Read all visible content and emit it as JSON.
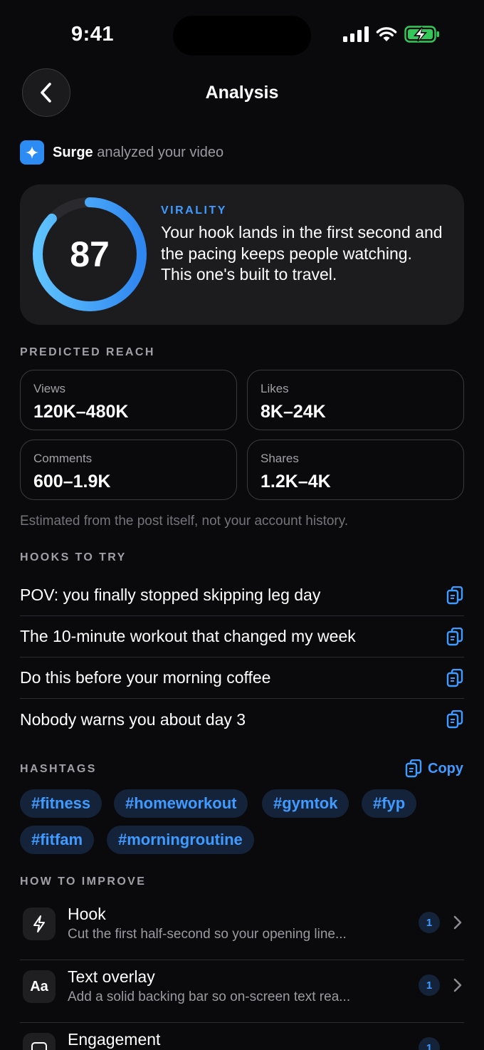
{
  "status_bar": {
    "time": "9:41"
  },
  "nav": {
    "title": "Analysis",
    "back_icon": "chevron-left-icon"
  },
  "surge": {
    "name": "Surge",
    "text": "analyzed your video",
    "icon": "sparkle-icon"
  },
  "virality": {
    "score": "87",
    "score_fraction": 0.87,
    "label": "VIRALITY",
    "description": "Your hook lands in the first second and the pacing keeps people watching. This one's built to travel."
  },
  "reach": {
    "section_label": "PREDICTED REACH",
    "stats": [
      {
        "label": "Views",
        "value": "120K–480K"
      },
      {
        "label": "Likes",
        "value": "8K–24K"
      },
      {
        "label": "Comments",
        "value": "600–1.9K"
      },
      {
        "label": "Shares",
        "value": "1.2K–4K"
      }
    ],
    "note": "Estimated from the post itself, not your account history."
  },
  "hooks": {
    "section_label": "HOOKS TO TRY",
    "items": [
      "POV: you finally stopped skipping leg day",
      "The 10-minute workout that changed my week",
      "Do this before your morning coffee",
      "Nobody warns you about day 3"
    ]
  },
  "hashtags": {
    "section_label": "HASHTAGS",
    "copy_label": "Copy",
    "tags": [
      "#fitness",
      "#homeworkout",
      "#gymtok",
      "#fyp",
      "#fitfam",
      "#morningroutine"
    ]
  },
  "improve": {
    "section_label": "HOW TO IMPROVE",
    "items": [
      {
        "title": "Hook",
        "desc": "Cut the first half-second so your opening line...",
        "count": "1",
        "icon": "lightning-icon"
      },
      {
        "title": "Text overlay",
        "desc": "Add a solid backing bar so on-screen text rea...",
        "count": "1",
        "icon": "text-aa-icon",
        "icon_text": "Aa"
      },
      {
        "title": "Engagement",
        "desc": "",
        "count": "1",
        "icon": "chat-icon"
      }
    ]
  },
  "colors": {
    "accent": "#3f9bff",
    "background": "#0a0a0c",
    "card": "#1c1c1f",
    "battery": "#34c759"
  }
}
